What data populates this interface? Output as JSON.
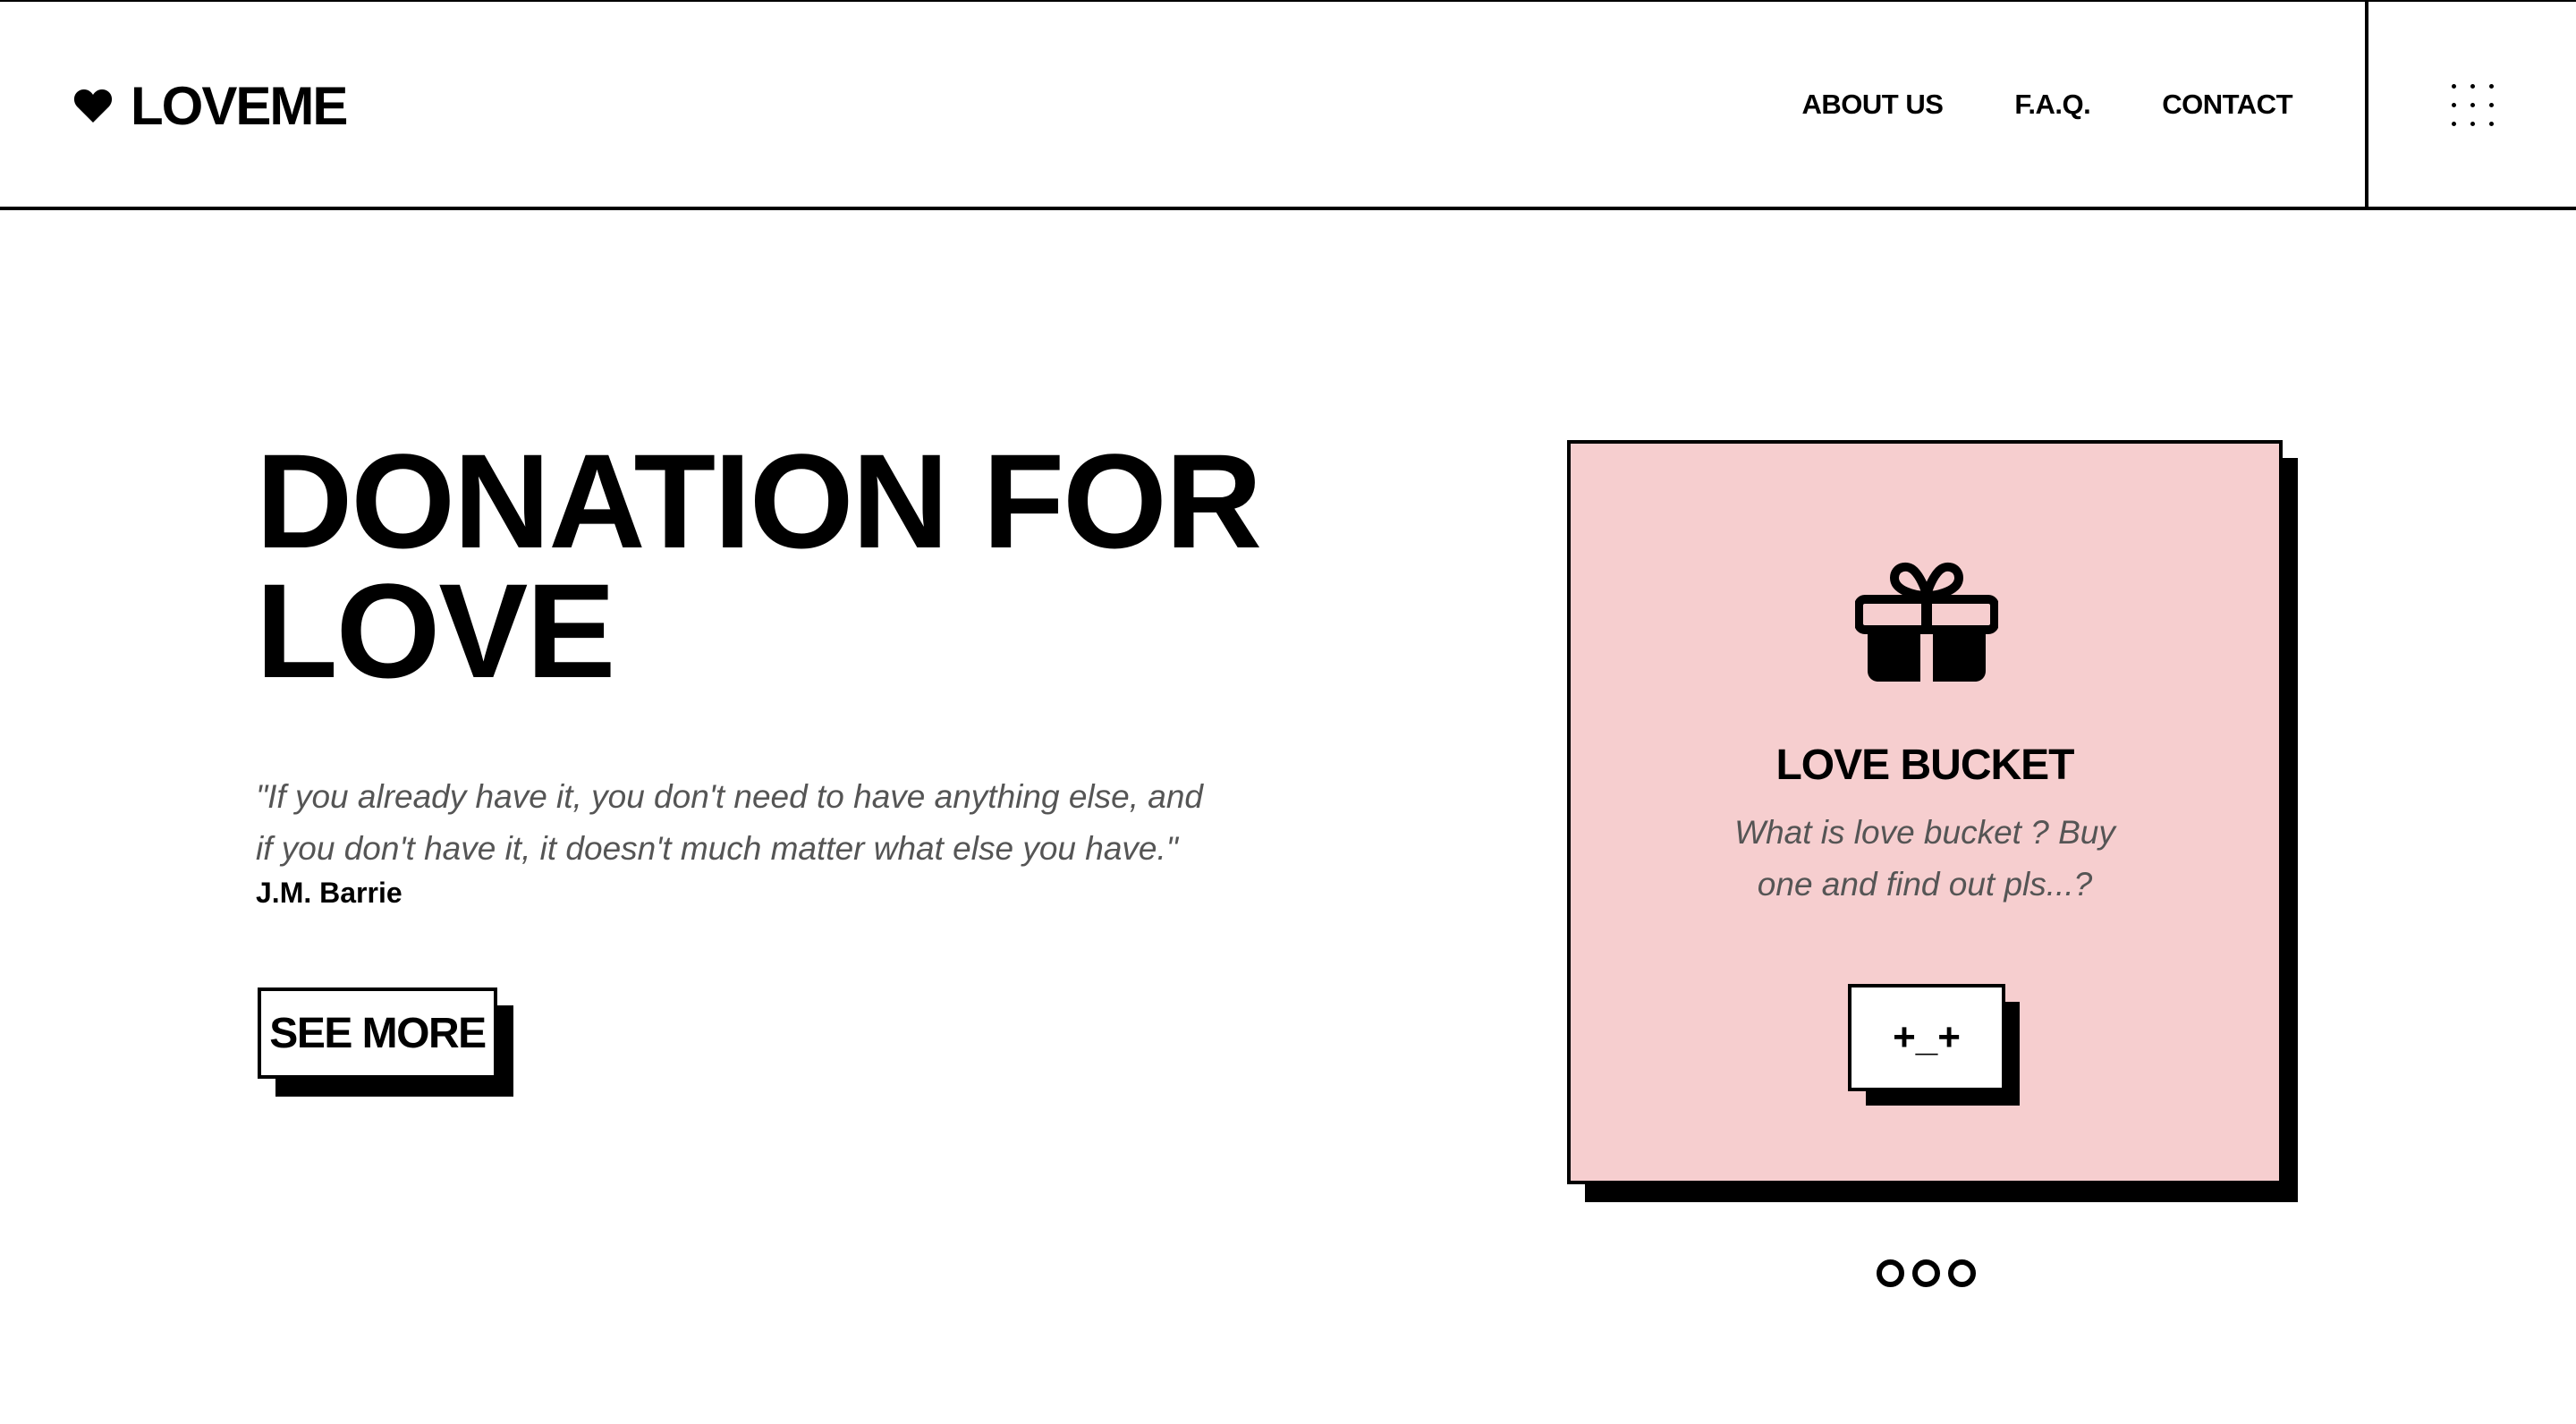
{
  "brand": {
    "name": "LOVEME",
    "icon": "heart-icon"
  },
  "nav": {
    "items": [
      "ABOUT US",
      "F.A.Q.",
      "CONTACT"
    ],
    "menu_icon": "grid-dots-icon"
  },
  "hero": {
    "title_line1": "DONATION FOR",
    "title_line2": "LOVE",
    "quote": "\"If you already have it, you don't need to have anything else, and if you don't have it, it doesn't much matter what else you have.\"",
    "author": "J.M. Barrie",
    "cta_label": "SEE MORE"
  },
  "card": {
    "icon": "gift-icon",
    "title": "LOVE BUCKET",
    "description": "What is love bucket ? Buy one and find out pls...?",
    "button_label": "+_+",
    "background": "#f6cecf"
  },
  "pager": {
    "count": 3
  }
}
